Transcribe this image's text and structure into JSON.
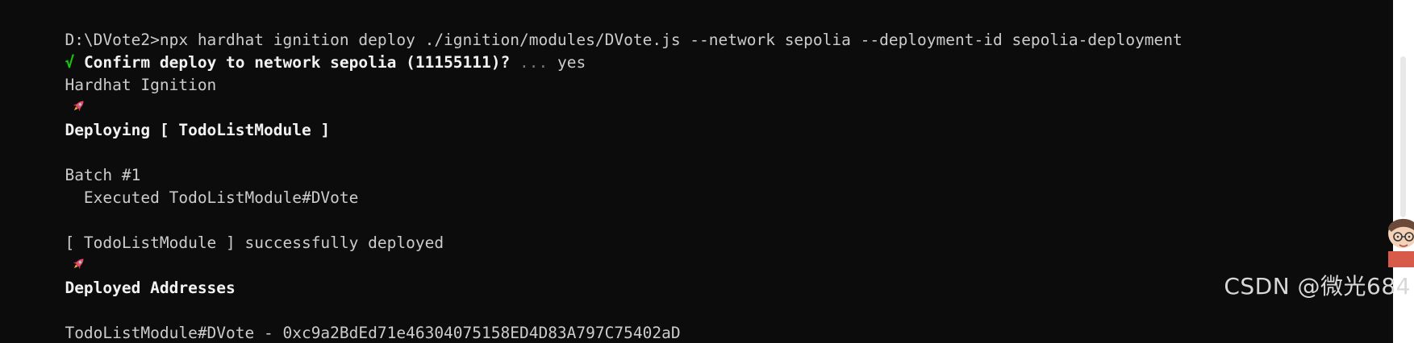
{
  "terminal": {
    "lines": [
      {
        "text": "D:\\DVote2>npx hardhat ignition deploy ./ignition/modules/DVote.js --network sepolia --deployment-id sepolia-deployment"
      },
      {
        "check": "√",
        "prompt": " Confirm deploy to network sepolia (11155111)?",
        "ellipsis": " ...",
        "answer": " yes"
      },
      {
        "text": "Hardhat Ignition",
        "icon": "rocket-icon"
      },
      {
        "text": ""
      },
      {
        "text": "Deploying [ TodoListModule ]"
      },
      {
        "text": ""
      },
      {
        "text": "Batch #1"
      },
      {
        "text": "  Executed TodoListModule#DVote"
      },
      {
        "text": ""
      },
      {
        "text": "[ TodoListModule ] successfully deployed",
        "icon": "rocket-icon"
      },
      {
        "text": ""
      },
      {
        "text": "Deployed Addresses"
      },
      {
        "text": ""
      },
      {
        "text": "TodoListModule#DVote - 0xc9a2BdEd71e46304075158ED4D83A797C75402aD"
      }
    ]
  },
  "watermark": "CSDN @微光684",
  "colors": {
    "background": "#0c0c0c",
    "text": "#cccccc",
    "bold_text": "#f2f2f2",
    "success": "#16c60c",
    "dim": "#767676",
    "rocket": "#e84a5f"
  }
}
